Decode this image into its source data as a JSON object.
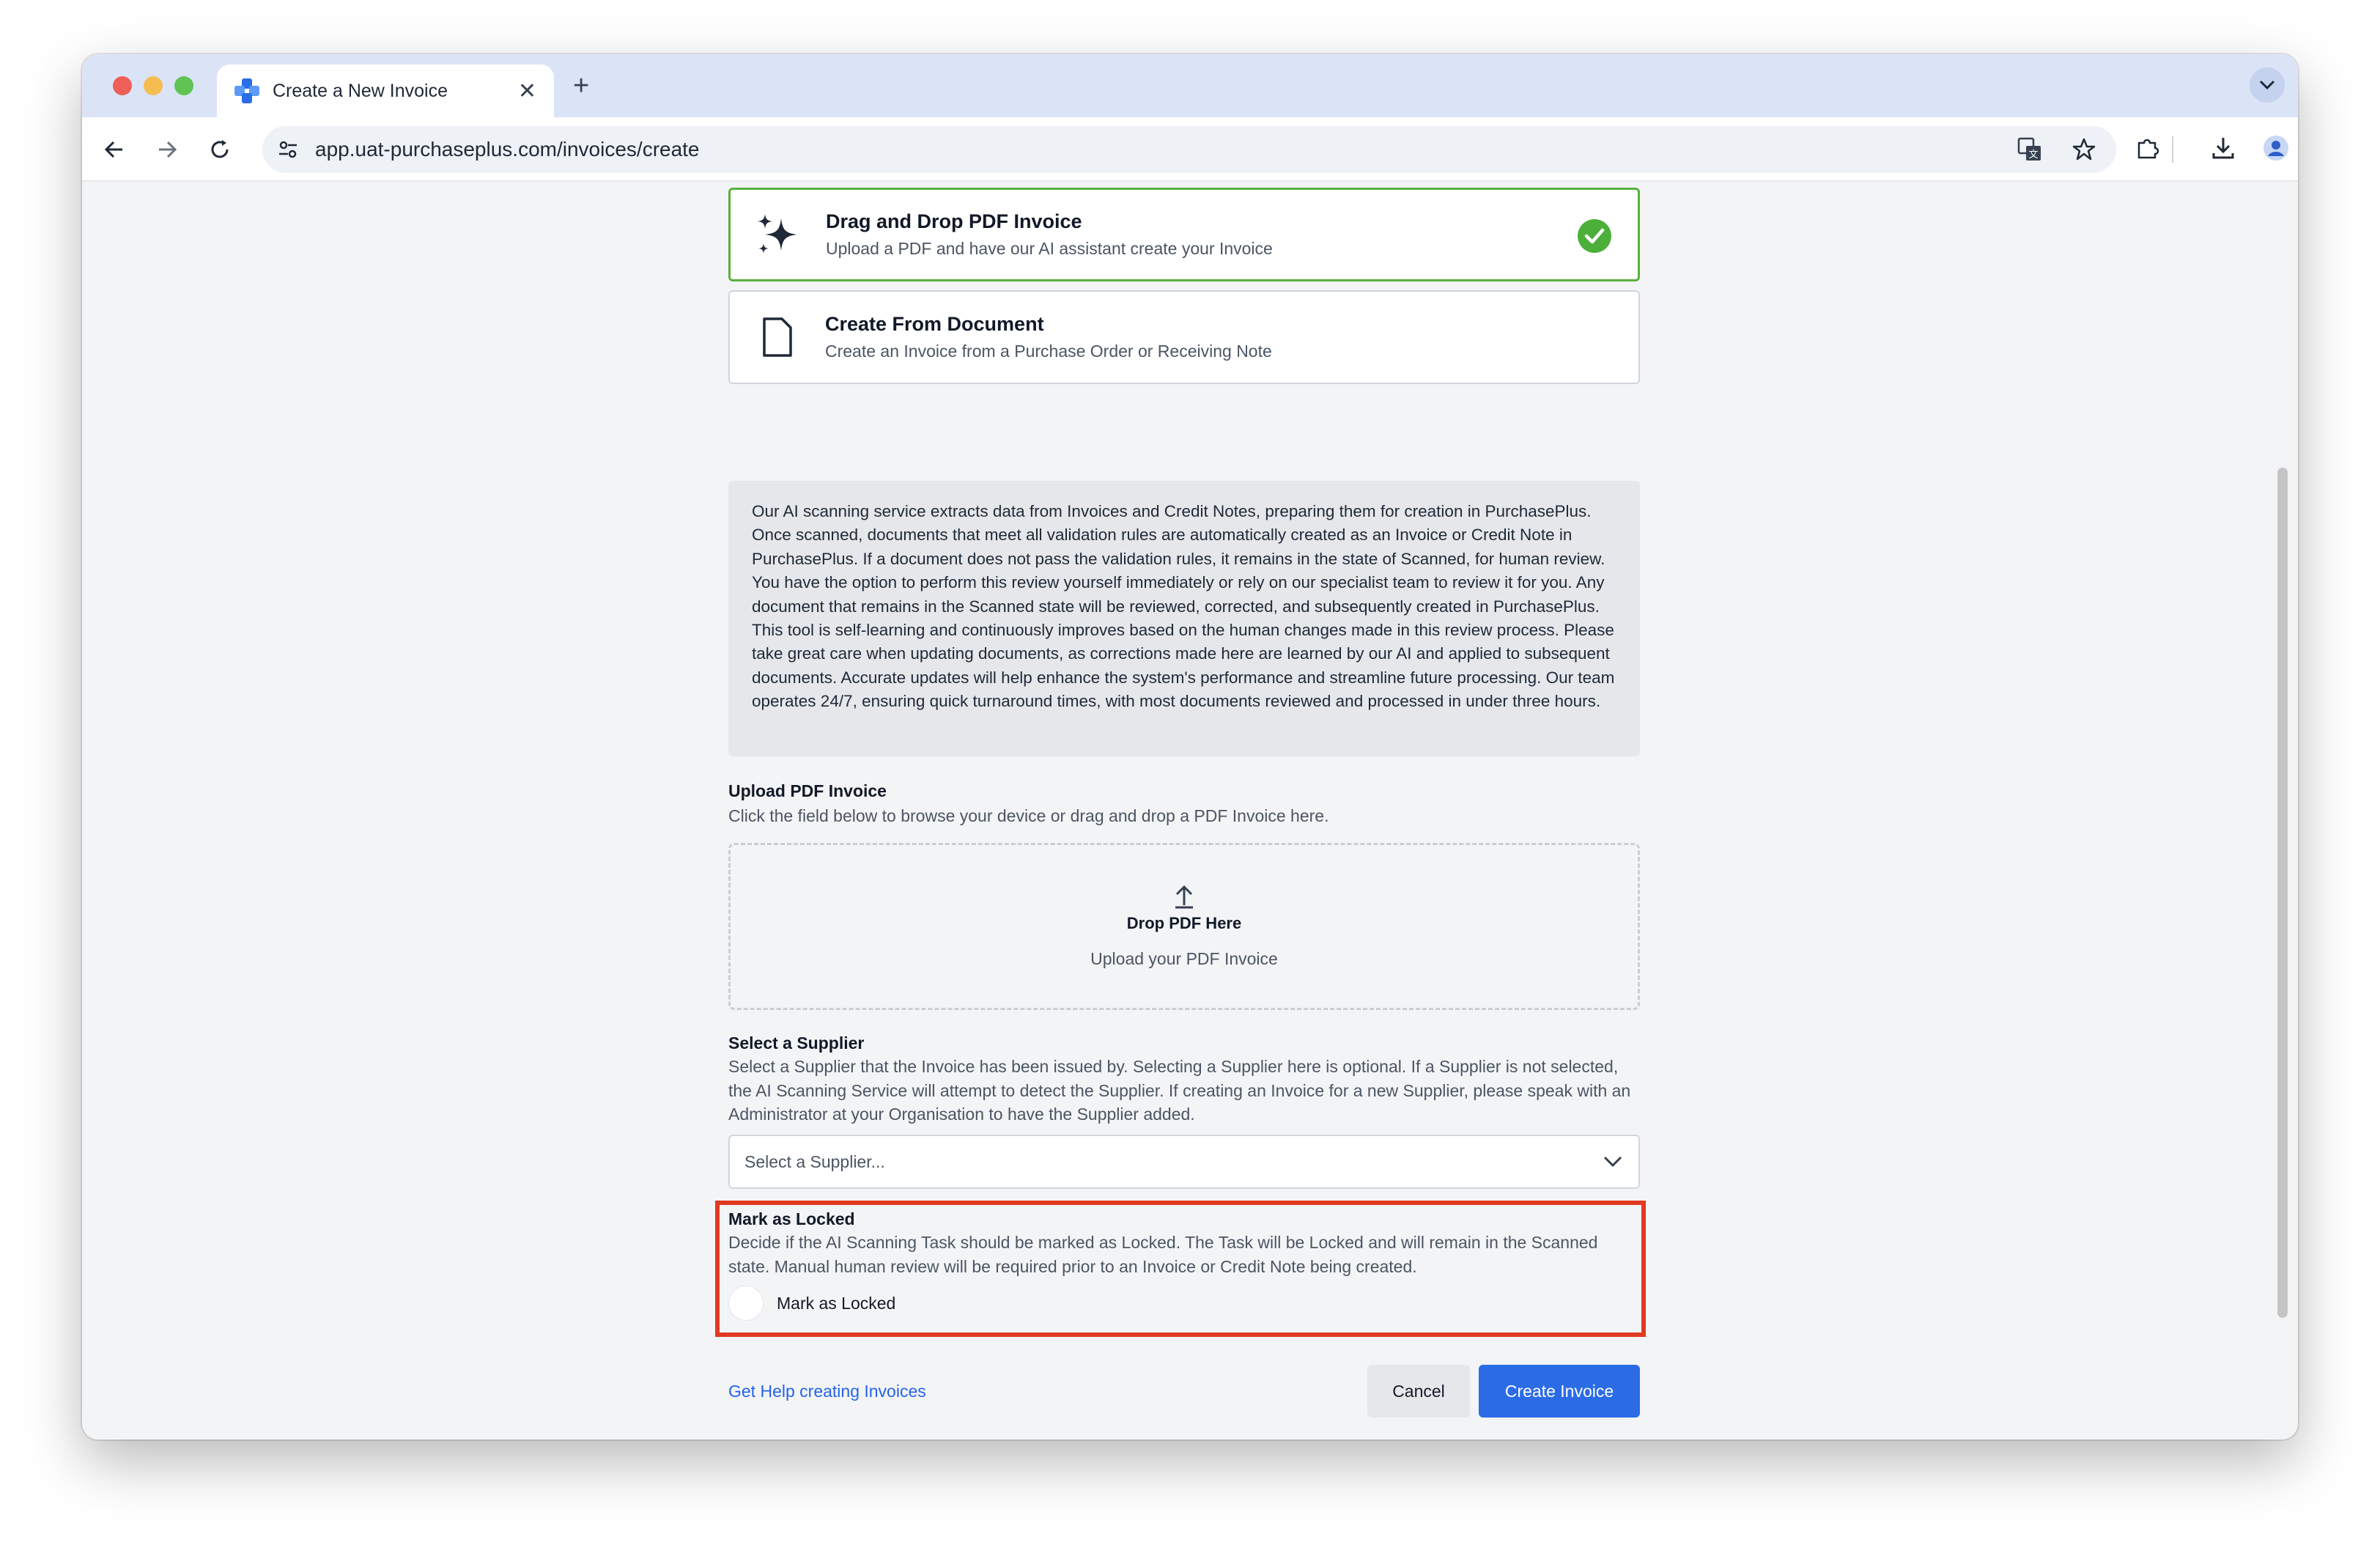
{
  "browser": {
    "tab_title": "Create a New Invoice",
    "url": "app.uat-purchaseplus.com/invoices/create"
  },
  "options": [
    {
      "title": "Drag and Drop PDF Invoice",
      "description": "Upload a PDF and have our AI assistant create your Invoice",
      "selected": true
    },
    {
      "title": "Create From Document",
      "description": "Create an Invoice from a Purchase Order or Receiving Note",
      "selected": false
    }
  ],
  "info_text": "Our AI scanning service extracts data from Invoices and Credit Notes, preparing them for creation in PurchasePlus. Once scanned, documents that meet all validation rules are automatically created as an Invoice or Credit Note in PurchasePlus. If a document does not pass the validation rules, it remains in the state of Scanned, for human review. You have the option to perform this review yourself immediately or rely on our specialist team to review it for you. Any document that remains in the Scanned state will be reviewed, corrected, and subsequently created in PurchasePlus. This tool is self-learning and continuously improves based on the human changes made in this review process. Please take great care when updating documents, as corrections made here are learned by our AI and applied to subsequent documents. Accurate updates will help enhance the system's performance and streamline future processing. Our team operates 24/7, ensuring quick turnaround times, with most documents reviewed and processed in under three hours.",
  "upload": {
    "label": "Upload PDF Invoice",
    "description": "Click the field below to browse your device or drag and drop a PDF Invoice here.",
    "drop_title": "Drop PDF Here",
    "drop_subtitle": "Upload your PDF Invoice"
  },
  "supplier": {
    "label": "Select a Supplier",
    "description": "Select a Supplier that the Invoice has been issued by. Selecting a Supplier here is optional. If a Supplier is not selected, the AI Scanning Service will attempt to detect the Supplier. If creating an Invoice for a new Supplier, please speak with an Administrator at your Organisation to have the Supplier added.",
    "placeholder": "Select a Supplier..."
  },
  "lock": {
    "label": "Mark as Locked",
    "description": "Decide if the AI Scanning Task should be marked as Locked. The Task will be Locked and will remain in the Scanned state. Manual human review will be required prior to an Invoice or Credit Note being created.",
    "toggle_label": "Mark as Locked",
    "checked": false
  },
  "footer": {
    "help_link": "Get Help creating Invoices",
    "cancel_label": "Cancel",
    "create_label": "Create Invoice"
  },
  "colors": {
    "accent": "#2b6ce6",
    "selected_border": "#58b03b",
    "highlight": "#e03a22"
  }
}
